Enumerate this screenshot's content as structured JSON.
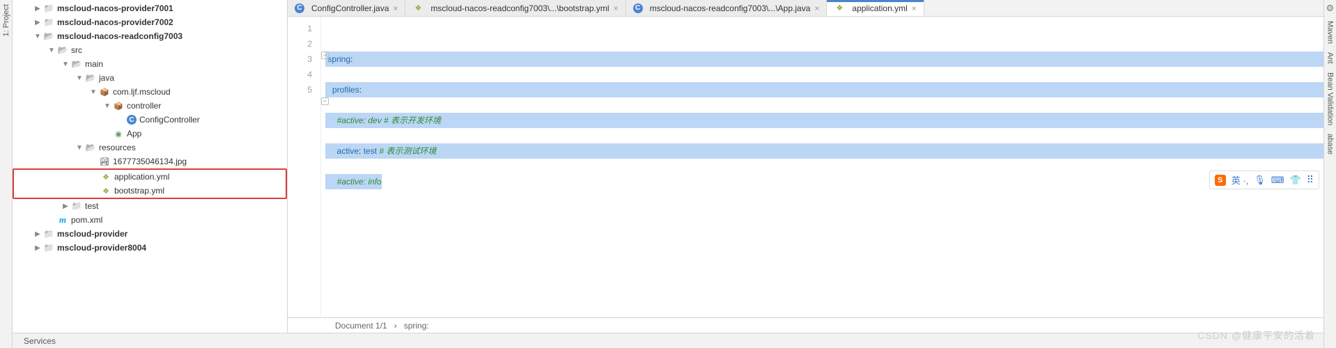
{
  "left_gutter": {
    "project": "1: Project"
  },
  "right_gutter": {
    "maven": "Maven",
    "ant": "Ant",
    "bean": "Bean Validation",
    "abase": "abase"
  },
  "tree": {
    "n0": "mscloud-nacos-provider7001",
    "n1": "mscloud-nacos-provider7002",
    "n2": "mscloud-nacos-readconfig7003",
    "n3": "src",
    "n4": "main",
    "n5": "java",
    "n6": "com.ljf.mscloud",
    "n7": "controller",
    "n8": "ConfigController",
    "n9": "App",
    "n10": "resources",
    "n11": "1677735046134.jpg",
    "n12": "application.yml",
    "n13": "bootstrap.yml",
    "n14": "test",
    "n15": "pom.xml",
    "n16": "mscloud-provider",
    "n17": "mscloud-provider8004"
  },
  "tabs": {
    "t0": "ConfigController.java",
    "t1": "mscloud-nacos-readconfig7003\\...\\bootstrap.yml",
    "t2": "mscloud-nacos-readconfig7003\\...\\App.java",
    "t3": "application.yml"
  },
  "gutter": {
    "l1": "1",
    "l2": "2",
    "l3": "3",
    "l4": "4",
    "l5": "5"
  },
  "code": {
    "l1a": "spring",
    "colon": ":",
    "l2a": "profiles",
    "l3a": "#active: dev # 表示开发环境",
    "l4a": "active",
    "l4b": ": ",
    "l4c": "test",
    "l4d": " # 表示测试环境",
    "l5a": "#active: info"
  },
  "status": {
    "doc": "Document 1/1",
    "sep": "›",
    "loc": "spring:"
  },
  "services": "Services",
  "sogou": {
    "txt": "英 ·,",
    "mic": "🎤",
    "kbd": "⌨",
    "shirt": "👕",
    "grid": "⦁⦁"
  },
  "watermark": "CSDN @健康平安的活着"
}
